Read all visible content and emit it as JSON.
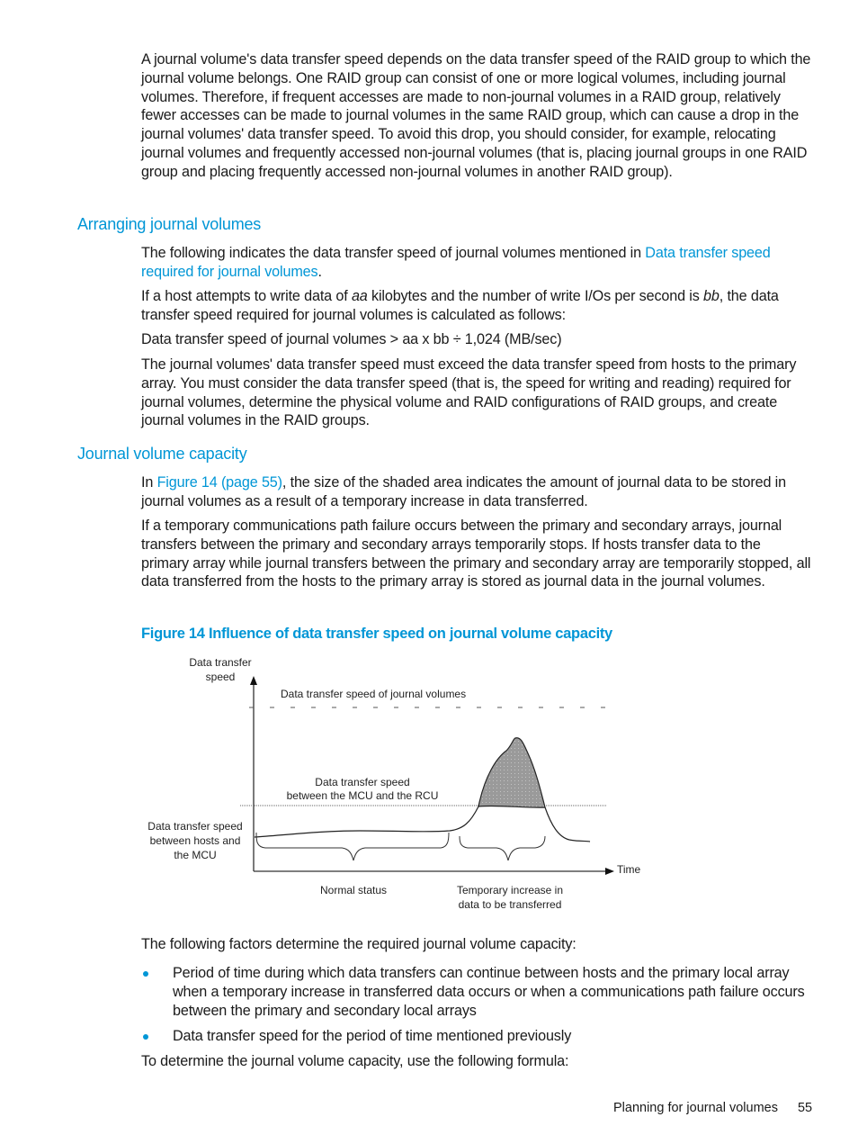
{
  "intro_paragraph": "A journal volume's data transfer speed depends on the data transfer speed of the RAID group to which the journal volume belongs. One RAID group can consist of one or more logical volumes, including journal volumes. Therefore, if frequent accesses are made to non-journal volumes in a RAID group, relatively fewer accesses can be made to journal volumes in the same RAID group, which can cause a drop in the journal volumes' data transfer speed. To avoid this drop, you should consider, for example, relocating journal volumes and frequently accessed non-journal volumes (that is, placing journal groups in one RAID group and placing frequently accessed non-journal volumes in another RAID group).",
  "section_arranging": {
    "heading": "Arranging journal volumes",
    "p1_prefix": "The following indicates the data transfer speed of journal volumes mentioned in ",
    "p1_link": "Data transfer speed required for journal volumes",
    "p1_suffix": ".",
    "p2_part1": "If a host attempts to write data of ",
    "p2_var1": "aa",
    "p2_part2": " kilobytes and the number of write I/Os per second is ",
    "p2_var2": "bb",
    "p2_part3": ", the data transfer speed required for journal volumes is calculated as follows:",
    "formula": "Data transfer speed of journal volumes > aa x bb ÷ 1,024 (MB/sec)",
    "p3": "The journal volumes' data transfer speed must exceed the data transfer speed from hosts to the primary array. You must consider the data transfer speed (that is, the speed for writing and reading) required for journal volumes, determine the physical volume and RAID configurations of RAID groups, and create journal volumes in the RAID groups."
  },
  "section_capacity": {
    "heading": "Journal volume capacity",
    "p1_prefix": "In ",
    "p1_link": "Figure 14 (page 55)",
    "p1_suffix": ", the size of the shaded area indicates the amount of journal data to be stored in journal volumes as a result of a temporary increase in data transferred.",
    "p2": "If a temporary communications path failure occurs between the primary and secondary arrays, journal transfers between the primary and secondary arrays temporarily stops. If hosts transfer data to the primary array while journal transfers between the primary and secondary array are temporarily stopped, all data transferred from the hosts to the primary array is stored as journal data in the journal volumes."
  },
  "figure": {
    "caption": "Figure 14 Influence of data transfer speed on journal volume capacity",
    "y_axis_label_line1": "Data transfer",
    "y_axis_label_line2": "speed",
    "x_axis_label": "Time",
    "journal_line_label": "Data transfer speed of journal volumes",
    "mcu_rcu_label_line1": "Data transfer speed",
    "mcu_rcu_label_line2": "between the MCU and the RCU",
    "hosts_label_line1": "Data transfer speed",
    "hosts_label_line2": "between hosts and",
    "hosts_label_line3": "the MCU",
    "normal_label": "Normal status",
    "increase_label_line1": "Temporary increase in",
    "increase_label_line2": "data to be transferred",
    "shade_color": "#999999"
  },
  "factors": {
    "intro": "The following factors determine the required journal volume capacity:",
    "items": [
      "Period of time during which data transfers can continue between hosts and the primary local array when a temporary increase in transferred data occurs or when a communications path failure occurs between the primary and secondary local arrays",
      "Data transfer speed for the period of time mentioned previously"
    ],
    "outro": "To determine the journal volume capacity, use the following formula:"
  },
  "footer": {
    "section_title": "Planning for journal volumes",
    "page_number": "55"
  },
  "colors": {
    "accent": "#0096d6",
    "text": "#1a1a1a"
  }
}
